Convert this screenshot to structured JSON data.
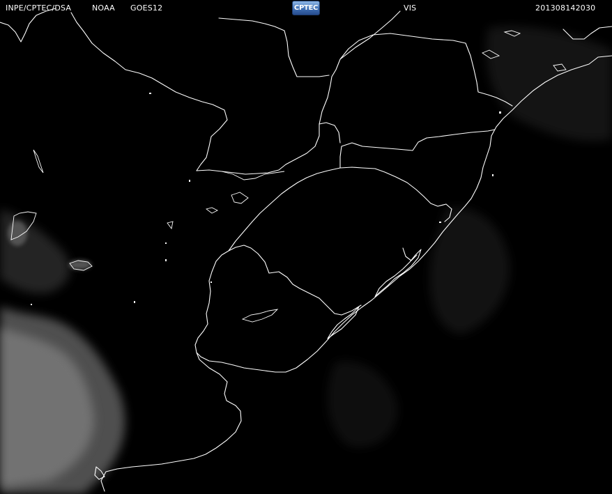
{
  "header": {
    "source": "INPE/CPTEC/DSA",
    "agency": "NOAA",
    "satellite": "GOES12",
    "logo_text": "CPTEC",
    "channel": "VIS",
    "timestamp": "201308142030"
  },
  "colors": {
    "background": "#000000",
    "header_text": "#ffffff",
    "boundaries": "#ffffff",
    "clouds": "#7a7a7a"
  }
}
